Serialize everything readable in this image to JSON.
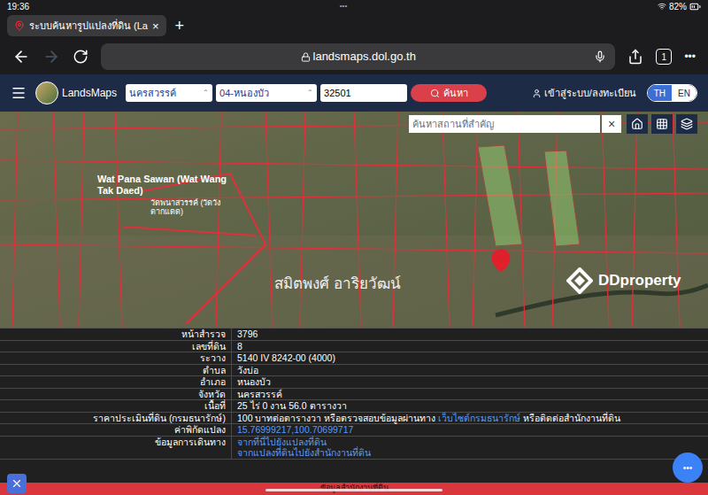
{
  "status_bar": {
    "time": "19:36",
    "dots": "•••",
    "battery": "82%"
  },
  "browser": {
    "tab_title": "ระบบค้นหารูปแปลงที่ดิน (La",
    "tab_close": "×",
    "new_tab": "+",
    "url": "landsmaps.dol.go.th",
    "tab_count": "1",
    "more": "•••",
    "forward_enabled": false
  },
  "app_header": {
    "logo": "LandsMaps",
    "province": "นครสวรรค์",
    "district": "04-หนองบัว",
    "parcel_number": "32501",
    "search_button": "ค้นหา",
    "login": "เข้าสู่ระบบ/ลงทะเบียน",
    "languages": [
      {
        "label": "TH",
        "selected": true
      },
      {
        "label": "EN",
        "selected": false
      }
    ]
  },
  "map": {
    "search_placeholder": "ค้นหาสถานที่สำคัญ",
    "clear": "×",
    "place_label_en": "Wat Pana Sawan (Wat Wang Tak Daed)",
    "place_label_th": "วัดพนาสวรรค์ (วัดวังตากแดด)",
    "watermark": "สมิตพงศ์ อาริยวัฒน์",
    "brand": "DDproperty"
  },
  "parcel_info": {
    "rows": [
      {
        "label": "หน้าสำรวจ",
        "lines": [
          [
            {
              "text": "3796",
              "link": false
            }
          ]
        ]
      },
      {
        "label": "เลขที่ดิน",
        "lines": [
          [
            {
              "text": "8",
              "link": false
            }
          ]
        ]
      },
      {
        "label": "ระวาง",
        "lines": [
          [
            {
              "text": "5140 IV 8242-00 (4000)",
              "link": false
            }
          ]
        ]
      },
      {
        "label": "ตำบล",
        "lines": [
          [
            {
              "text": "วังบ่อ",
              "link": false
            }
          ]
        ]
      },
      {
        "label": "อำเภอ",
        "lines": [
          [
            {
              "text": "หนองบัว",
              "link": false
            }
          ]
        ]
      },
      {
        "label": "จังหวัด",
        "lines": [
          [
            {
              "text": "นครสวรรค์",
              "link": false
            }
          ]
        ]
      },
      {
        "label": "เนื้อที่",
        "lines": [
          [
            {
              "text": "25 ไร่ 0 งาน 56.0 ตารางวา",
              "link": false
            }
          ]
        ]
      },
      {
        "label": "ราคาประเมินที่ดิน (กรมธนารักษ์)",
        "lines": [
          [
            {
              "text": "100 บาทต่อตารางวา หรือตรวจสอบข้อมูลผ่านทาง ",
              "link": false
            },
            {
              "text": "เว็บไซต์กรมธนารักษ์",
              "link": true
            },
            {
              "text": " หรือติดต่อสำนักงานที่ดิน",
              "link": false
            }
          ]
        ]
      },
      {
        "label": "ค่าพิกัดแปลง",
        "lines": [
          [
            {
              "text": "15.76999217,100.70699717",
              "link": true
            }
          ]
        ]
      },
      {
        "label": "ข้อมูลการเดินทาง",
        "lines": [
          [
            {
              "text": "จากที่นี่ไปยังแปลงที่ดิน",
              "link": true
            }
          ],
          [
            {
              "text": "จากแปลงที่ดินไปยังสำนักงานที่ดิน",
              "link": true
            }
          ]
        ]
      }
    ]
  },
  "bottom_bar": {
    "text": "ข้อมูลสำนักงานที่ดิน"
  },
  "fab": "•••"
}
